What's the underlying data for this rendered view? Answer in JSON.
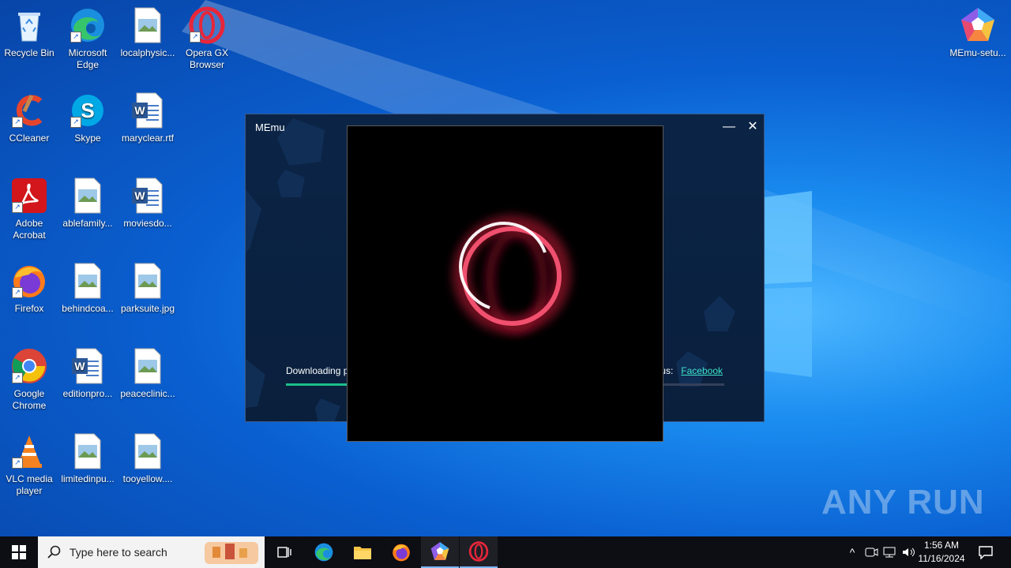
{
  "desktop": {
    "icons": [
      {
        "label": "Recycle Bin"
      },
      {
        "label": "Microsoft Edge"
      },
      {
        "label": "localphysic..."
      },
      {
        "label": "Opera GX Browser"
      },
      {
        "label": "CCleaner"
      },
      {
        "label": "Skype"
      },
      {
        "label": "maryclear.rtf"
      },
      {
        "label": "Adobe Acrobat"
      },
      {
        "label": "ablefamily..."
      },
      {
        "label": "moviesdo..."
      },
      {
        "label": "Firefox"
      },
      {
        "label": "behindcoa..."
      },
      {
        "label": "parksuite.jpg"
      },
      {
        "label": "Google Chrome"
      },
      {
        "label": "editionpro..."
      },
      {
        "label": "peaceclinic..."
      },
      {
        "label": "VLC media player"
      },
      {
        "label": "limitedinpu..."
      },
      {
        "label": "tooyellow...."
      },
      {
        "label": "MEmu-setu..."
      }
    ]
  },
  "memu_window": {
    "title": "MEmu",
    "minimize": "—",
    "close": "✕",
    "downloading_text": "Downloading p",
    "follow_text": "us:",
    "facebook_link": "Facebook",
    "progress": 0.14
  },
  "watermark": "ANY RUN",
  "taskbar": {
    "search_placeholder": "Type here to search",
    "time": "1:56 AM",
    "date": "11/16/2024"
  },
  "colors": {
    "accent": "#1bbf8a",
    "link": "#3ee1c8",
    "opera_red": "#e8263a"
  }
}
